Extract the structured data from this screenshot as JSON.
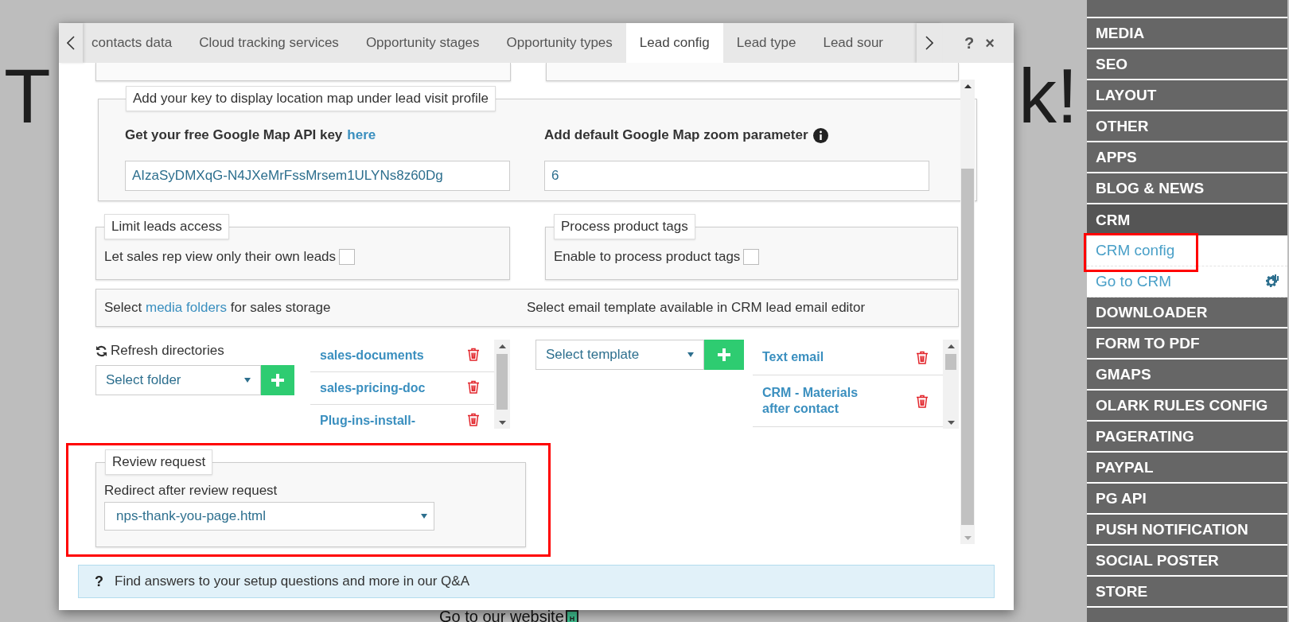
{
  "background_page": {
    "heading_left": "T",
    "heading_right": "k!",
    "link": "Go to our website",
    "badge": "H"
  },
  "dialog": {
    "tabs": [
      {
        "label": "contacts data",
        "selected": false
      },
      {
        "label": "Cloud tracking services",
        "selected": false
      },
      {
        "label": "Opportunity stages",
        "selected": false
      },
      {
        "label": "Opportunity types",
        "selected": false
      },
      {
        "label": "Lead config",
        "selected": true
      },
      {
        "label": "Lead type",
        "selected": false
      },
      {
        "label": "Lead sour",
        "selected": false
      }
    ],
    "help": "?",
    "close": "×",
    "map_key": {
      "legend": "Add your key to display location map under lead visit profile",
      "api_label": "Get your free Google Map API key",
      "api_link": "here",
      "api_value": "AIzaSyDMXqG-N4JXeMrFssMrsem1ULYNs8z60Dg",
      "zoom_label": "Add default Google Map zoom parameter",
      "zoom_value": "6"
    },
    "access": [
      {
        "legend": "Limit leads access",
        "label": "Let sales rep view only their own leads",
        "checked": false
      },
      {
        "legend": "Process product tags",
        "label": "Enable to process product tags",
        "checked": false
      }
    ],
    "storage_bar": {
      "folders_prefix": "Select",
      "folders_link": "media folders",
      "folders_suffix": "for sales storage",
      "templates_text": "Select email template available in CRM lead email editor"
    },
    "folders": {
      "refresh": "Refresh directories",
      "placeholder": "Select folder",
      "items": [
        "sales-documents",
        "sales-pricing-doc",
        "Plug-ins-install-"
      ]
    },
    "templates": {
      "placeholder": "Select template",
      "items": [
        "Text email",
        "CRM - Materials after contact"
      ]
    },
    "review": {
      "legend": "Review request",
      "label": "Redirect after review request",
      "value": "nps-thank-you-page.html"
    },
    "info": {
      "icon": "?",
      "text": "Find answers to your setup questions and more in our Q&A"
    }
  },
  "sidebar": {
    "items": [
      {
        "label": "MEDIA",
        "expanded": false
      },
      {
        "label": "SEO",
        "expanded": false
      },
      {
        "label": "LAYOUT",
        "expanded": false
      },
      {
        "label": "OTHER",
        "expanded": false
      },
      {
        "label": "APPS",
        "expanded": false
      },
      {
        "label": "BLOG & NEWS",
        "expanded": false
      },
      {
        "label": "CRM",
        "expanded": true,
        "children": [
          {
            "label": "CRM config",
            "icon": false
          },
          {
            "label": "Go to CRM",
            "icon": true
          }
        ]
      },
      {
        "label": "DOWNLOADER",
        "expanded": false
      },
      {
        "label": "FORM TO PDF",
        "expanded": false
      },
      {
        "label": "GMAPS",
        "expanded": false
      },
      {
        "label": "OLARK RULES CONFIG",
        "expanded": false
      },
      {
        "label": "PAGERATING",
        "expanded": false
      },
      {
        "label": "PAYPAL",
        "expanded": false
      },
      {
        "label": "PG API",
        "expanded": false
      },
      {
        "label": "PUSH NOTIFICATION",
        "expanded": false
      },
      {
        "label": "SOCIAL POSTER",
        "expanded": false
      },
      {
        "label": "STORE",
        "expanded": false
      }
    ]
  }
}
